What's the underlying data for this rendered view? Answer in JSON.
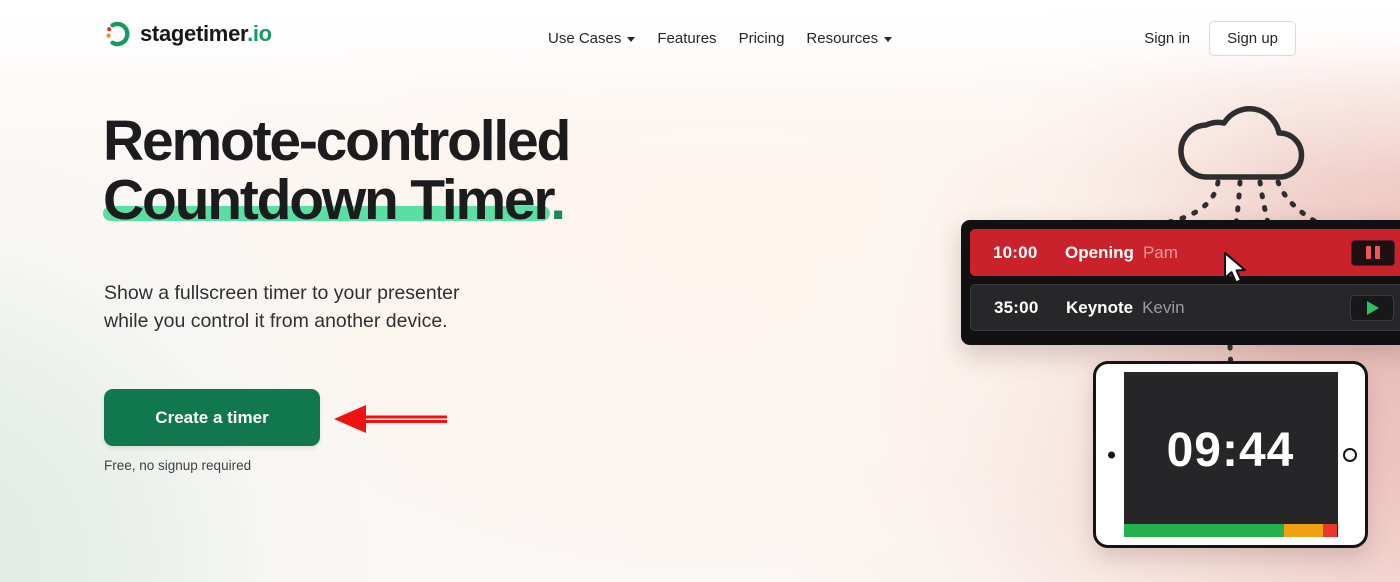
{
  "header": {
    "logo": {
      "name": "stagetimer",
      "tld": ".io",
      "icon": "stagetimer-arc-icon"
    },
    "nav": [
      {
        "label": "Use Cases",
        "has_caret": true
      },
      {
        "label": "Features",
        "has_caret": false
      },
      {
        "label": "Pricing",
        "has_caret": false
      },
      {
        "label": "Resources",
        "has_caret": true
      }
    ],
    "signin_label": "Sign in",
    "signup_label": "Sign up"
  },
  "hero": {
    "headline_line1": "Remote-controlled",
    "headline_line2": "Countdown Timer",
    "headline_period": ".",
    "subtitle_line1": "Show a fullscreen timer to your presenter",
    "subtitle_line2": "while you control it from another device.",
    "cta_label": "Create a timer",
    "cta_note": "Free, no signup required"
  },
  "annotation": {
    "arrow": "red-left-arrow",
    "color": "#f01111",
    "points_at": "Create a timer"
  },
  "illustration": {
    "cloud_icon": "cloud-outline-icon",
    "dashed_connections": 4,
    "controller": {
      "rows": [
        {
          "time": "10:00",
          "title": "Opening",
          "speaker": "Pam",
          "state": "running",
          "button": "pause-button",
          "bg_color": "#c9222b"
        },
        {
          "time": "35:00",
          "title": "Keynote",
          "speaker": "Kevin",
          "state": "stopped",
          "button": "play-button",
          "bg_color": "#272729"
        }
      ],
      "cursor": "mouse-pointer-cursor"
    },
    "tablet": {
      "time": "09:44",
      "progress": [
        {
          "color": "#23b14d",
          "percent": 75
        },
        {
          "color": "#f0a113",
          "percent": 18
        },
        {
          "color": "#e8372c",
          "percent": 7
        }
      ]
    }
  },
  "colors": {
    "brand_green": "#11774f",
    "accent_mint": "#5adfa3",
    "logo_green": "#179a63",
    "timer_red": "#c9222b",
    "annotation_red": "#f01111"
  }
}
